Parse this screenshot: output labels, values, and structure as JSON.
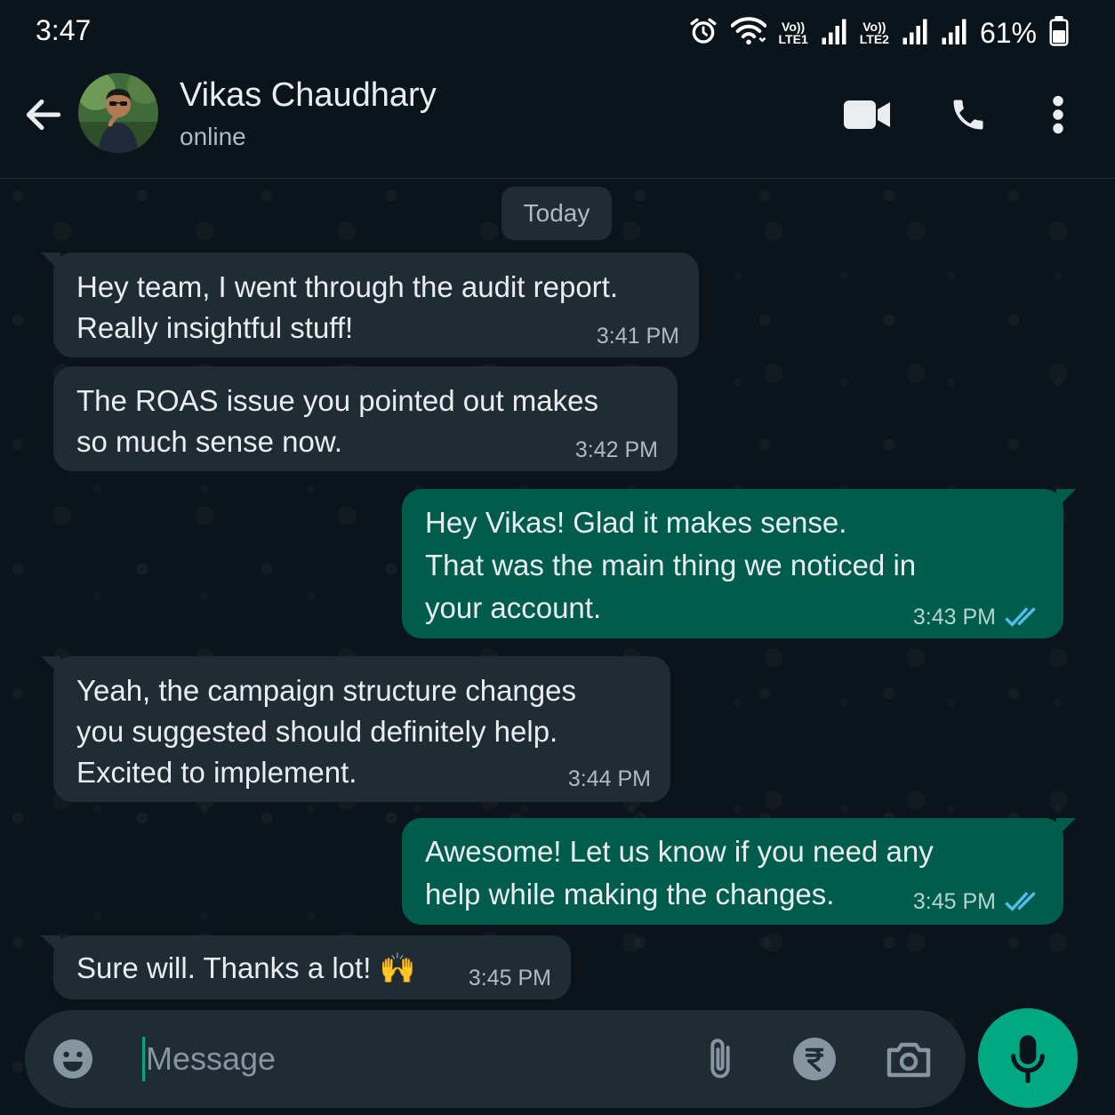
{
  "status_bar": {
    "time": "3:47",
    "sim1_volte": "Vo))",
    "sim1_lte": "LTE1",
    "sim2_volte": "Vo))",
    "sim2_lte": "LTE2",
    "battery_percent": "61%",
    "battery_level": 0.61,
    "icons": [
      "alarm-icon",
      "wifi-icon",
      "signal-sim1-icon",
      "signal-sim2-icon",
      "signal-icon",
      "battery-icon"
    ]
  },
  "header": {
    "contact_name": "Vikas Chaudhary",
    "contact_status": "online",
    "icons": [
      "back-arrow-icon",
      "video-call-icon",
      "phone-icon",
      "more-vert-icon"
    ]
  },
  "chat": {
    "date_chip": "Today",
    "messages": [
      {
        "direction": "incoming",
        "lines": [
          "Hey team, I went through the audit report.",
          "Really insightful stuff!"
        ],
        "time": "3:41 PM"
      },
      {
        "direction": "incoming",
        "lines": [
          "The ROAS issue you pointed out makes",
          "so much sense now."
        ],
        "time": "3:42 PM"
      },
      {
        "direction": "outgoing",
        "lines": [
          "Hey Vikas! Glad it makes sense.",
          "That was the main thing we noticed in",
          "your account."
        ],
        "time": "3:43 PM",
        "status": "read"
      },
      {
        "direction": "incoming",
        "lines": [
          "Yeah, the campaign structure changes",
          "you suggested should definitely help.",
          "Excited to implement."
        ],
        "time": "3:44 PM"
      },
      {
        "direction": "outgoing",
        "lines": [
          "Awesome! Let us know if you need any",
          "help while making the changes."
        ],
        "time": "3:45 PM",
        "status": "read"
      },
      {
        "direction": "incoming",
        "lines": [
          "Sure will. Thanks a lot! 🙌"
        ],
        "time": "3:45 PM"
      }
    ]
  },
  "composer": {
    "placeholder": "Message",
    "value": "",
    "icons": [
      "emoji-icon",
      "attach-icon",
      "rupee-payment-icon",
      "camera-icon",
      "mic-icon"
    ]
  },
  "colors": {
    "background": "#0b141a",
    "incoming_bubble": "#202c33",
    "outgoing_bubble": "#005c4b",
    "accent": "#00a884",
    "read_ticks": "#53bdeb"
  }
}
